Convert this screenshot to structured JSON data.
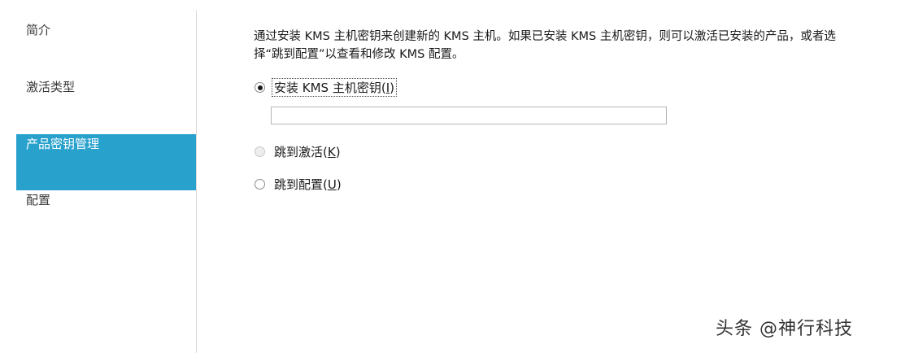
{
  "sidebar": {
    "items": [
      {
        "label": "简介"
      },
      {
        "label": "激活类型"
      },
      {
        "label": "产品密钥管理"
      },
      {
        "label": "配置"
      }
    ],
    "selected_color": "#29a1cd"
  },
  "main": {
    "description": "通过安装 KMS 主机密钥来创建新的 KMS 主机。如果已安装 KMS 主机密钥，则可以激活已安装的产品，或者选择“跳到配置”以查看和修改 KMS 配置。",
    "options": [
      {
        "label": "安装 KMS 主机密钥",
        "accesskey": "I",
        "checked": true,
        "enabled": true
      },
      {
        "label": "跳到激活",
        "accesskey": "K",
        "checked": false,
        "enabled": false
      },
      {
        "label": "跳到配置",
        "accesskey": "U",
        "checked": false,
        "enabled": true
      }
    ],
    "key_input": {
      "value": "",
      "placeholder": ""
    }
  },
  "watermark": "头条 @神行科技"
}
